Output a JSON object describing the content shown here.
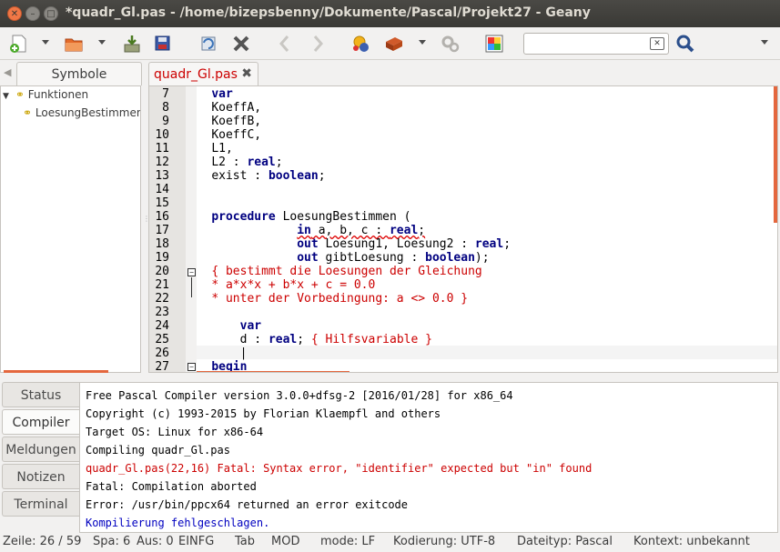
{
  "window": {
    "title": "*quadr_Gl.pas - /home/bizepsbenny/Dokumente/Pascal/Projekt27 - Geany"
  },
  "toolbar": {
    "icons": [
      "new-file-icon",
      "open-file-icon",
      "save-icon",
      "save-all-icon",
      "revert-icon",
      "close-icon",
      "back-icon",
      "forward-icon",
      "compile-icon",
      "build-icon",
      "settings-icon",
      "color-chooser-icon",
      "search-icon"
    ],
    "search_value": ""
  },
  "sidebar": {
    "tab_label": "Symbole",
    "tree": [
      {
        "label": "Funktionen",
        "level": 0
      },
      {
        "label": "LoesungBestimmen",
        "level": 1
      }
    ]
  },
  "editor": {
    "file_tab": "quadr_Gl.pas",
    "lines": [
      {
        "n": "7",
        "segs": [
          [
            "kw",
            "var"
          ]
        ],
        "indent": "    "
      },
      {
        "n": "8",
        "segs": [
          [
            "t",
            "KoeffA,"
          ]
        ],
        "indent": "    "
      },
      {
        "n": "9",
        "segs": [
          [
            "t",
            "KoeffB,"
          ]
        ],
        "indent": "    "
      },
      {
        "n": "10",
        "segs": [
          [
            "t",
            "KoeffC,"
          ]
        ],
        "indent": "    "
      },
      {
        "n": "11",
        "segs": [
          [
            "t",
            "L1,"
          ]
        ],
        "indent": "    "
      },
      {
        "n": "12",
        "segs": [
          [
            "t",
            "L2 : "
          ],
          [
            "kw",
            "real"
          ],
          [
            "t",
            ";"
          ]
        ],
        "indent": "    "
      },
      {
        "n": "13",
        "segs": [
          [
            "t",
            "exist : "
          ],
          [
            "kw",
            "boolean"
          ],
          [
            "t",
            ";"
          ]
        ],
        "indent": "    "
      },
      {
        "n": "14",
        "segs": [],
        "indent": ""
      },
      {
        "n": "15",
        "segs": [],
        "indent": ""
      },
      {
        "n": "16",
        "segs": [
          [
            "kw",
            "procedure"
          ],
          [
            "t",
            " LoesungBestimmen ("
          ]
        ],
        "indent": "    "
      },
      {
        "n": "17",
        "segs": [
          [
            "kw",
            "in"
          ],
          [
            "t",
            " a, b, c : "
          ],
          [
            "kw",
            "real"
          ],
          [
            "t",
            ";"
          ]
        ],
        "indent": "                "
      },
      {
        "n": "18",
        "segs": [
          [
            "kw",
            "out"
          ],
          [
            "t",
            " Loesung1, Loesung2 : "
          ],
          [
            "kw",
            "real"
          ],
          [
            "t",
            ";"
          ]
        ],
        "indent": "                "
      },
      {
        "n": "19",
        "segs": [
          [
            "kw",
            "out"
          ],
          [
            "t",
            " gibtLoesung : "
          ],
          [
            "kw",
            "boolean"
          ],
          [
            "t",
            ");"
          ]
        ],
        "indent": "                "
      },
      {
        "n": "20",
        "segs": [
          [
            "cm",
            "{ bestimmt die Loesungen der Gleichung"
          ]
        ],
        "indent": "    "
      },
      {
        "n": "21",
        "segs": [
          [
            "cm",
            "* a*x*x + b*x + c = 0.0"
          ]
        ],
        "indent": "    "
      },
      {
        "n": "22",
        "segs": [
          [
            "cm",
            "* unter der Vorbedingung: a <> 0.0 }"
          ]
        ],
        "indent": "    "
      },
      {
        "n": "23",
        "segs": [],
        "indent": ""
      },
      {
        "n": "24",
        "segs": [
          [
            "kw",
            "var"
          ]
        ],
        "indent": "        "
      },
      {
        "n": "25",
        "segs": [
          [
            "t",
            "d : "
          ],
          [
            "kw",
            "real"
          ],
          [
            "t",
            "; "
          ],
          [
            "cm",
            "{ Hilfsvariable }"
          ]
        ],
        "indent": "        "
      },
      {
        "n": "26",
        "segs": [
          [
            "t",
            "|"
          ]
        ],
        "indent": "        "
      },
      {
        "n": "27",
        "segs": [
          [
            "kw",
            "begin"
          ]
        ],
        "indent": "    "
      }
    ]
  },
  "bottom": {
    "tabs": [
      "Status",
      "Compiler",
      "Meldungen",
      "Notizen",
      "Terminal"
    ],
    "active_tab": "Compiler",
    "messages": [
      {
        "text": "Free Pascal Compiler version 3.0.0+dfsg-2 [2016/01/28] for x86_64",
        "kind": "normal"
      },
      {
        "text": "Copyright (c) 1993-2015 by Florian Klaempfl and others",
        "kind": "normal"
      },
      {
        "text": "Target OS: Linux for x86-64",
        "kind": "normal"
      },
      {
        "text": "Compiling quadr_Gl.pas",
        "kind": "normal"
      },
      {
        "text": "quadr_Gl.pas(22,16) Fatal: Syntax error, \"identifier\" expected but \"in\" found",
        "kind": "err"
      },
      {
        "text": "Fatal: Compilation aborted",
        "kind": "normal"
      },
      {
        "text": "Error: /usr/bin/ppcx64 returned an error exitcode",
        "kind": "normal"
      },
      {
        "text": "Kompilierung fehlgeschlagen.",
        "kind": "blue"
      }
    ]
  },
  "status": {
    "zeile": "Zeile: 26 / 59",
    "spa": "Spa: 6",
    "aus": "Aus: 0",
    "einfg": "EINFG",
    "tab": "Tab",
    "mod": "MOD",
    "mode": "mode: LF",
    "kodierung": "Kodierung: UTF-8",
    "dateityp": "Dateityp: Pascal",
    "kontext": "Kontext: unbekannt"
  }
}
